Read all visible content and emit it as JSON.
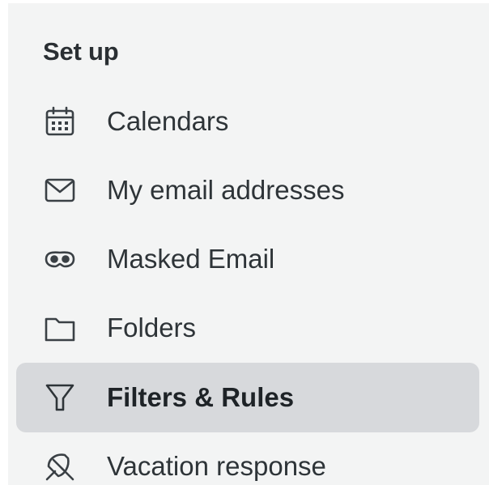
{
  "section": {
    "title": "Set up"
  },
  "nav": {
    "items": [
      {
        "label": "Calendars",
        "icon": "calendar-icon",
        "selected": false
      },
      {
        "label": "My email addresses",
        "icon": "envelope-icon",
        "selected": false
      },
      {
        "label": "Masked Email",
        "icon": "mask-icon",
        "selected": false
      },
      {
        "label": "Folders",
        "icon": "folder-icon",
        "selected": false
      },
      {
        "label": "Filters & Rules",
        "icon": "filter-icon",
        "selected": true
      },
      {
        "label": "Vacation response",
        "icon": "beach-umbrella-icon",
        "selected": false
      }
    ]
  },
  "colors": {
    "panel_background": "#f3f4f4",
    "selected_background": "#d7d9dc",
    "text": "#2e3438",
    "icon": "#3a4045"
  }
}
